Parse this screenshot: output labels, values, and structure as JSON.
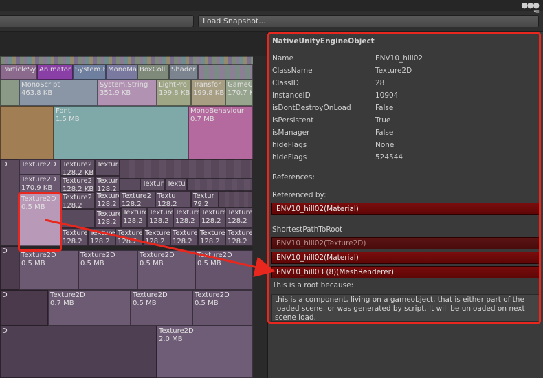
{
  "toolbar": {
    "load_snapshot_label": "Load Snapshot...",
    "window_icons": "●●●"
  },
  "treemap": {
    "cells": [
      {
        "name": "ParticleSy",
        "size": ""
      },
      {
        "name": "Animator",
        "size": ""
      },
      {
        "name": "System.E",
        "size": ""
      },
      {
        "name": "MonoMa",
        "size": ""
      },
      {
        "name": "BoxColl",
        "size": ""
      },
      {
        "name": "Shader",
        "size": ""
      },
      {
        "name": "MonoScript",
        "size": "463.8 KB"
      },
      {
        "name": "System.String",
        "size": "351.9 KB"
      },
      {
        "name": "LightPro",
        "size": "199.8 KB"
      },
      {
        "name": "Transfor",
        "size": "199.8 KB"
      },
      {
        "name": "GameO",
        "size": "170.7 K"
      },
      {
        "name": "Font",
        "size": "1.5 MB"
      },
      {
        "name": "MonoBehaviour",
        "size": "0.7 MB"
      },
      {
        "name": "Texture2D",
        "size": "170.9 KB"
      },
      {
        "name": "Texture2D",
        "size": "0.5 MB"
      },
      {
        "name": "Texture2D",
        "size": "0.5 MB"
      },
      {
        "name": "Texture2D",
        "size": "0.5 MB"
      },
      {
        "name": "Texture2D",
        "size": "0.5 MB"
      },
      {
        "name": "Texture2D",
        "size": "0.5 MB"
      },
      {
        "name": "Texture2D",
        "size": "0.7 MB"
      },
      {
        "name": "Texture2D",
        "size": "0.5 MB"
      },
      {
        "name": "Texture2D",
        "size": "0.5 MB"
      },
      {
        "name": "Texture2D",
        "size": "2.0 MB"
      }
    ],
    "small_labels": [
      "Texture2",
      "Texture2",
      "Texture2",
      "Textur",
      "Textur",
      "Texture2",
      "Texture2",
      "Textu",
      "Texture2",
      "Texture2",
      "Texture2",
      "Texture2",
      "Texture2",
      "Textur",
      "Texture2",
      "Texture2",
      "Textur",
      "Texture2",
      "Texture2",
      "Textur",
      "Texture2",
      "Texture2"
    ],
    "small_sizes": [
      "128.2 KB",
      "128.2 KB",
      "128.2",
      "128.2",
      "128.2",
      "128.2",
      "128.2",
      "128.2",
      "128.2",
      "128.2",
      "128.2",
      "128.2",
      "128.2",
      "128.2",
      "79.2"
    ],
    "edge_labels": [
      "D",
      "D",
      "D",
      "D"
    ]
  },
  "inspector": {
    "title": "NativeUnityEngineObject",
    "properties": [
      {
        "key": "Name",
        "value": "ENV10_hill02"
      },
      {
        "key": "ClassName",
        "value": "Texture2D"
      },
      {
        "key": "ClassID",
        "value": "28"
      },
      {
        "key": "instanceID",
        "value": "10904"
      },
      {
        "key": "isDontDestroyOnLoad",
        "value": "False"
      },
      {
        "key": "isPersistent",
        "value": "True"
      },
      {
        "key": "isManager",
        "value": "False"
      },
      {
        "key": "hideFlags",
        "value": "None"
      },
      {
        "key": "hideFlags",
        "value": "524544"
      }
    ],
    "references_label": "References:",
    "referenced_by_label": "Referenced by:",
    "referenced_by": [
      "ENV10_hill02(Material)"
    ],
    "shortest_path_label": "ShortestPathToRoot",
    "shortest_path": [
      "ENV10_hill02(Texture2D)",
      "ENV10_hill02(Material)",
      "ENV10_hill03 (8)(MeshRenderer)"
    ],
    "root_reason_label": "This is a root because:",
    "root_reason": "this is a component, living on a gameobject, that is either part of the loaded scene, or was generated by script. It will be unloaded on next scene load."
  },
  "colors": {
    "annotation": "#e8281e",
    "reference_bar": "#6e0a0a"
  }
}
